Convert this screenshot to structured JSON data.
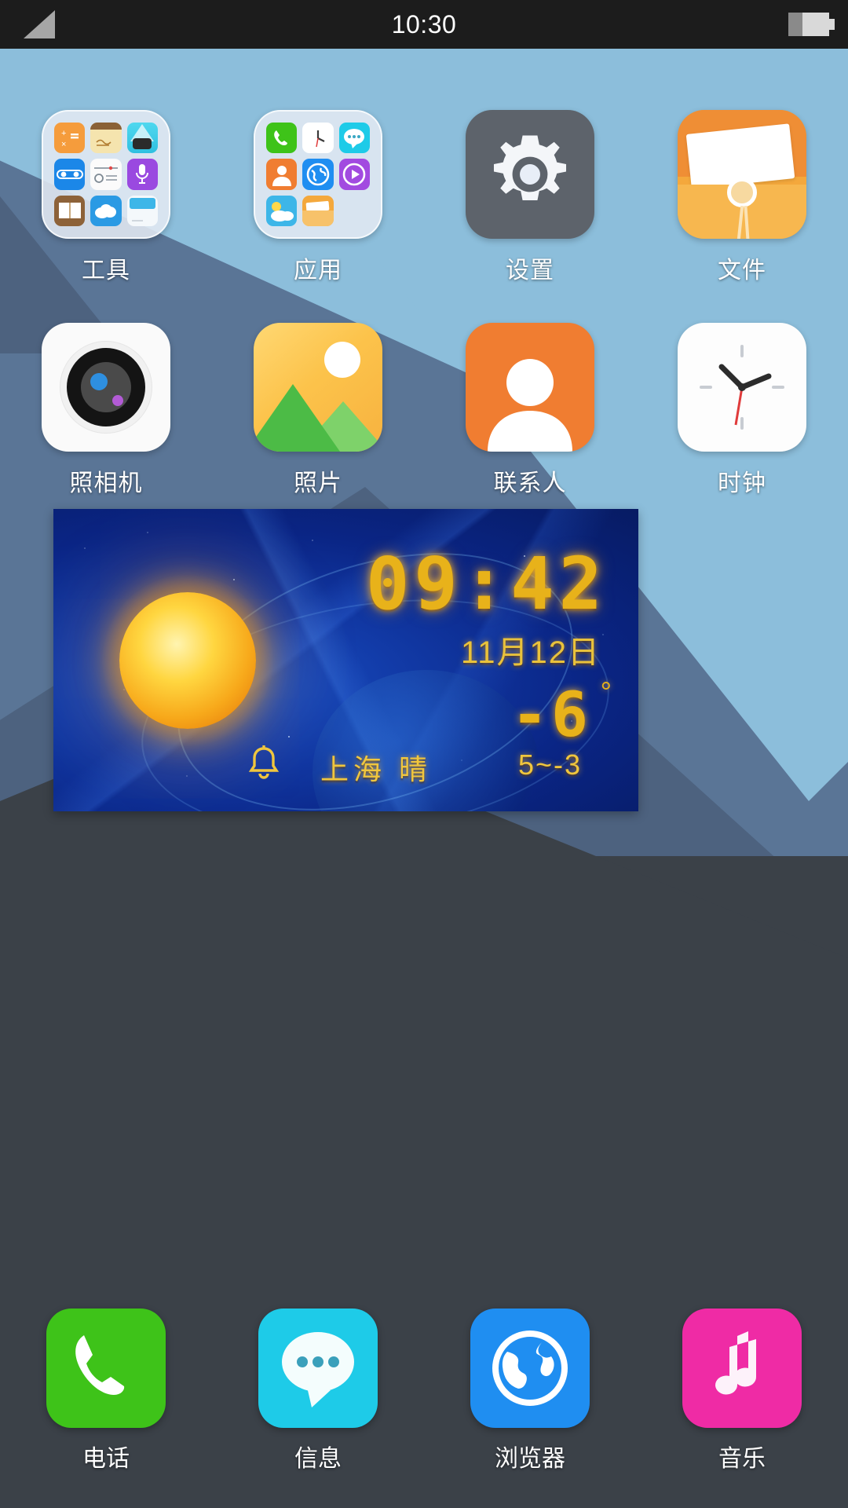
{
  "status_bar": {
    "time": "10:30",
    "signal_icon": "signal-triangle-icon",
    "battery_icon": "battery-icon"
  },
  "home_screen": {
    "rows": [
      [
        {
          "label": "工具",
          "name": "folder-tools",
          "type": "folder",
          "mini_icons": [
            "calculator-icon",
            "notes-icon",
            "flashlight-icon",
            "toggle-settings-icon",
            "recorder-icon",
            "microphone-icon",
            "book-icon",
            "cloud-icon",
            "memo-icon"
          ]
        },
        {
          "label": "应用",
          "name": "folder-apps",
          "type": "folder",
          "mini_icons": [
            "phone-icon",
            "clock-icon",
            "message-icon",
            "contacts-icon",
            "browser-icon",
            "video-player-icon",
            "weather-icon",
            "file-box-icon"
          ]
        },
        {
          "label": "设置",
          "name": "app-settings",
          "type": "settings",
          "icon": "gear-icon"
        },
        {
          "label": "文件",
          "name": "app-files",
          "type": "file",
          "icon": "envelope-folder-icon"
        }
      ],
      [
        {
          "label": "照相机",
          "name": "app-camera",
          "type": "camera",
          "icon": "camera-lens-icon"
        },
        {
          "label": "照片",
          "name": "app-photos",
          "type": "photo",
          "icon": "picture-icon"
        },
        {
          "label": "联系人",
          "name": "app-contacts",
          "type": "contact",
          "icon": "person-icon"
        },
        {
          "label": "时钟",
          "name": "app-clock",
          "type": "clock",
          "icon": "analog-clock-icon"
        }
      ]
    ]
  },
  "widget": {
    "name": "clock-weather-widget",
    "time": "09:42",
    "date": "11月12日",
    "temperature": "-6",
    "degree_symbol": "°",
    "alarm_icon": "bell-icon",
    "city": "上海",
    "condition": "晴",
    "city_condition": "上海  晴",
    "temp_range": "5~-3"
  },
  "dock": {
    "items": [
      {
        "label": "电话",
        "name": "dock-phone",
        "icon": "phone-handset-icon",
        "color": "#3ec319"
      },
      {
        "label": "信息",
        "name": "dock-messages",
        "icon": "speech-bubble-icon",
        "color": "#1ecbe8"
      },
      {
        "label": "浏览器",
        "name": "dock-browser",
        "icon": "globe-icon",
        "color": "#1f8ef1"
      },
      {
        "label": "音乐",
        "name": "dock-music",
        "icon": "music-note-icon",
        "color": "#ef2ba5"
      }
    ]
  },
  "colors": {
    "wallpaper_light": "#8cbedb",
    "wallpaper_mid": "#5a7596",
    "wallpaper_deep": "#4d627f",
    "wallpaper_dark": "#3b4148",
    "status_bar_bg": "#1c1c1c",
    "widget_gold": "#e8b21a"
  }
}
